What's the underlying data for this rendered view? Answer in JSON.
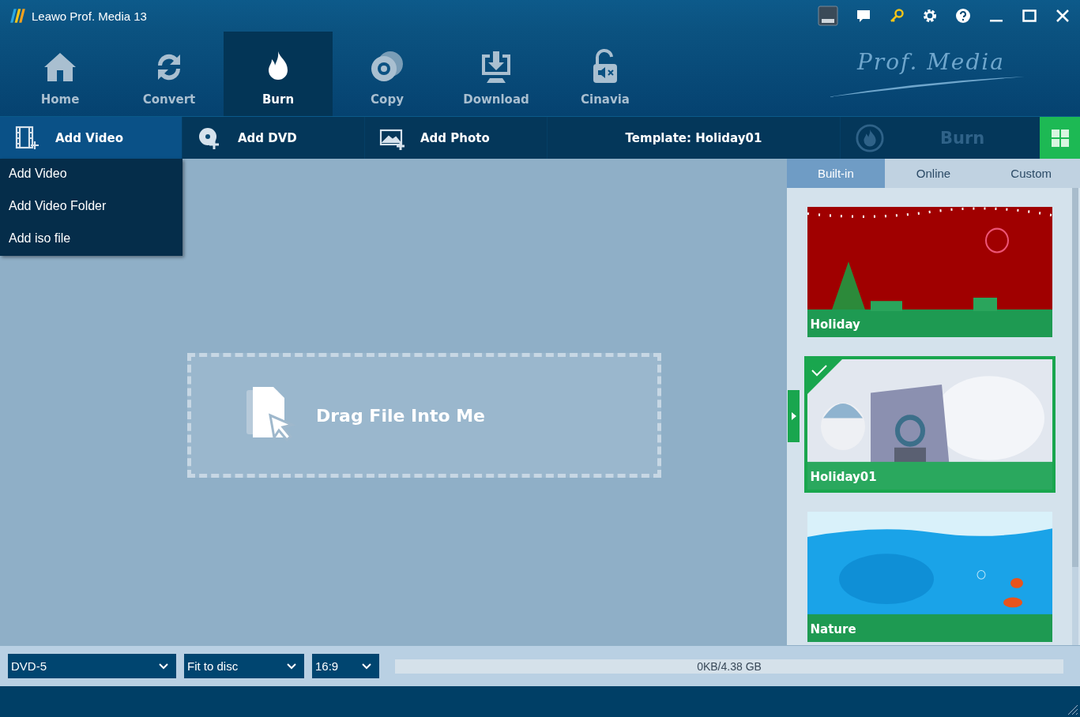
{
  "window": {
    "title": "Leawo Prof. Media 13"
  },
  "nav_tabs": [
    {
      "kind": "home",
      "label": "Home",
      "selected": false
    },
    {
      "kind": "convert",
      "label": "Convert",
      "selected": false
    },
    {
      "kind": "burn",
      "label": "Burn",
      "selected": true
    },
    {
      "kind": "copy",
      "label": "Copy",
      "selected": false
    },
    {
      "kind": "download",
      "label": "Download",
      "selected": false
    },
    {
      "kind": "cinavia",
      "label": "Cinavia",
      "selected": false
    }
  ],
  "brand": "Prof. Media",
  "toolbar": {
    "buttons": [
      {
        "kind": "video",
        "label": "Add Video",
        "selected": true
      },
      {
        "kind": "dvd",
        "label": "Add DVD",
        "selected": false
      },
      {
        "label": "Add Photo",
        "selected": false
      }
    ],
    "template_label": "Template: Holiday01",
    "burn_button": {
      "label": "Burn",
      "disabled": true
    }
  },
  "menu": {
    "items": [
      "Add Video",
      "Add Video Folder",
      "Add iso file"
    ]
  },
  "drop_zone": {
    "label": "Drag File Into Me"
  },
  "template_tabs": [
    {
      "label": "Built-in",
      "selected": true
    },
    {
      "label": "Online",
      "selected": false
    },
    {
      "label": "Custom",
      "selected": false
    }
  ],
  "templates": [
    {
      "kind": "festive",
      "name": "Holiday",
      "selected": false
    },
    {
      "kind": "snowy",
      "name": "Holiday01",
      "selected": true
    },
    {
      "kind": "underwater",
      "name": "Nature",
      "selected": false
    }
  ],
  "bottom": {
    "disc_type": "DVD-5",
    "quality": "Fit to disc",
    "aspect": "16:9",
    "capacity": {
      "text": "0KB/4.38 GB"
    }
  }
}
